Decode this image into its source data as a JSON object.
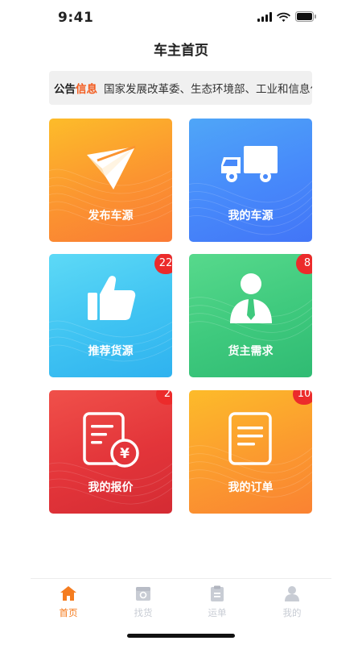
{
  "status_bar": {
    "time": "9:41"
  },
  "header": {
    "title": "车主首页"
  },
  "notice": {
    "label_part1": "公告",
    "label_part2": "信息",
    "text": "国家发展改革委、生态环境部、工业和信息化部"
  },
  "tiles": [
    {
      "label": "发布车源",
      "icon": "paper-plane-icon",
      "badge": ""
    },
    {
      "label": "我的车源",
      "icon": "truck-icon",
      "badge": ""
    },
    {
      "label": "推荐货源",
      "icon": "thumbs-up-icon",
      "badge": "22"
    },
    {
      "label": "货主需求",
      "icon": "person-icon",
      "badge": "8"
    },
    {
      "label": "我的报价",
      "icon": "yen-document-icon",
      "badge": "2"
    },
    {
      "label": "我的订单",
      "icon": "document-icon",
      "badge": "10"
    }
  ],
  "tabbar": {
    "items": [
      {
        "label": "首页",
        "icon": "home-icon",
        "active": true
      },
      {
        "label": "找货",
        "icon": "find-goods-icon",
        "active": false
      },
      {
        "label": "运单",
        "icon": "waybill-icon",
        "active": false
      },
      {
        "label": "我的",
        "icon": "profile-icon",
        "active": false
      }
    ]
  },
  "colors": {
    "accent": "#f57c1f",
    "notice_highlight": "#f25a1d",
    "badge": "#ec2b2b",
    "tab_inactive": "#c8ccd4"
  }
}
